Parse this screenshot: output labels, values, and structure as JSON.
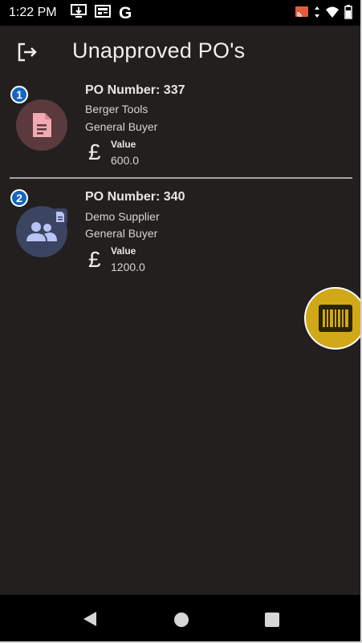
{
  "status_bar": {
    "time": "1:22 PM",
    "left_icons": [
      "download-icon",
      "news-icon",
      "google-icon"
    ],
    "google_glyph": "G",
    "right_icons": [
      "cast-icon",
      "data-arrows-icon",
      "wifi-icon",
      "battery-icon"
    ]
  },
  "header": {
    "title": "Unapproved PO's",
    "logout_icon": "logout-icon"
  },
  "purchase_orders": [
    {
      "badge": "1",
      "po_number": "PO Number: 337",
      "supplier": "Berger Tools",
      "buyer": "General Buyer",
      "currency_symbol": "£",
      "value_label": "Value",
      "value": "600.0",
      "avatar_icon": "document-icon",
      "avatar_color": "#5a3a3d",
      "icon_color": "#f3a9b3"
    },
    {
      "badge": "2",
      "po_number": "PO Number: 340",
      "supplier": "Demo Supplier",
      "buyer": "General Buyer",
      "currency_symbol": "£",
      "value_label": "Value",
      "value": "1200.0",
      "avatar_icon": "people-icon",
      "avatar_color": "#3b4460",
      "icon_color": "#b9c4f5"
    }
  ],
  "fab": {
    "icon": "barcode-icon",
    "color": "#d0a818"
  },
  "nav_bar": {
    "icons": [
      "back-icon",
      "home-icon",
      "recents-icon"
    ]
  },
  "colors": {
    "background": "#231f1f",
    "divider": "#a9a4a4",
    "text_primary": "#e9e5e5"
  }
}
